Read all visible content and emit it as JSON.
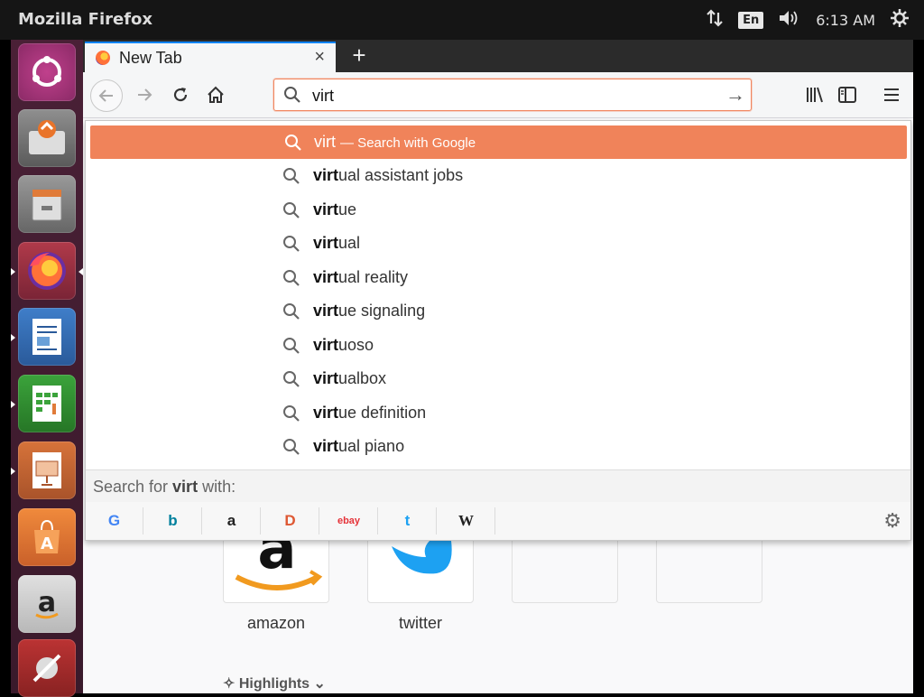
{
  "system": {
    "app_title": "Mozilla Firefox",
    "keyboard_layout": "En",
    "time": "6:13 AM",
    "icons": [
      "network-icon",
      "keyboard-layout-icon",
      "volume-icon",
      "power-gear-icon"
    ]
  },
  "launcher": {
    "items": [
      "ubuntu-dash-icon",
      "software-updater-icon",
      "files-icon",
      "firefox-icon",
      "writer-icon",
      "calc-icon",
      "impress-icon",
      "software-center-icon",
      "amazon-icon",
      "system-settings-icon"
    ]
  },
  "browser": {
    "tab": {
      "title": "New Tab",
      "close": "×"
    },
    "new_tab_symbol": "+",
    "urlbar": {
      "value": "virt",
      "go_symbol": "→"
    },
    "toolbar_icons": [
      "library-icon",
      "sidebar-icon",
      "menu-icon"
    ]
  },
  "autocomplete": {
    "heading": {
      "query": "virt",
      "sub": "— Search with Google"
    },
    "suggestions": [
      {
        "bold": "virt",
        "rest": "ual assistant jobs"
      },
      {
        "bold": "virt",
        "rest": "ue"
      },
      {
        "bold": "virt",
        "rest": "ual"
      },
      {
        "bold": "virt",
        "rest": "ual reality"
      },
      {
        "bold": "virt",
        "rest": "ue signaling"
      },
      {
        "bold": "virt",
        "rest": "uoso"
      },
      {
        "bold": "virt",
        "rest": "ualbox"
      },
      {
        "bold": "virt",
        "rest": "ue definition"
      },
      {
        "bold": "virt",
        "rest": "ual piano"
      }
    ],
    "search_for": {
      "prefix": "Search for ",
      "query": "virt",
      "suffix": " with:"
    },
    "engines": [
      {
        "name": "google-engine",
        "glyph": "G",
        "color": "#4285f4"
      },
      {
        "name": "bing-engine",
        "glyph": "b",
        "color": "#00809d"
      },
      {
        "name": "amazon-engine",
        "glyph": "a",
        "color": "#222222"
      },
      {
        "name": "duckduckgo-engine",
        "glyph": "D",
        "color": "#de5833"
      },
      {
        "name": "ebay-engine",
        "glyph": "ebay",
        "color": "#e53238"
      },
      {
        "name": "twitter-engine",
        "glyph": "t",
        "color": "#1da1f2"
      },
      {
        "name": "wikipedia-engine",
        "glyph": "W",
        "color": "#222222"
      }
    ]
  },
  "newtab": {
    "top_sites": [
      {
        "label": "amazon"
      },
      {
        "label": "twitter"
      },
      {
        "label": ""
      },
      {
        "label": ""
      }
    ],
    "highlights_label": "Highlights"
  },
  "colors": {
    "accent_selected": "#f0835a",
    "urlbar_focus": "#f1865f",
    "tab_accent": "#0a84ff"
  }
}
